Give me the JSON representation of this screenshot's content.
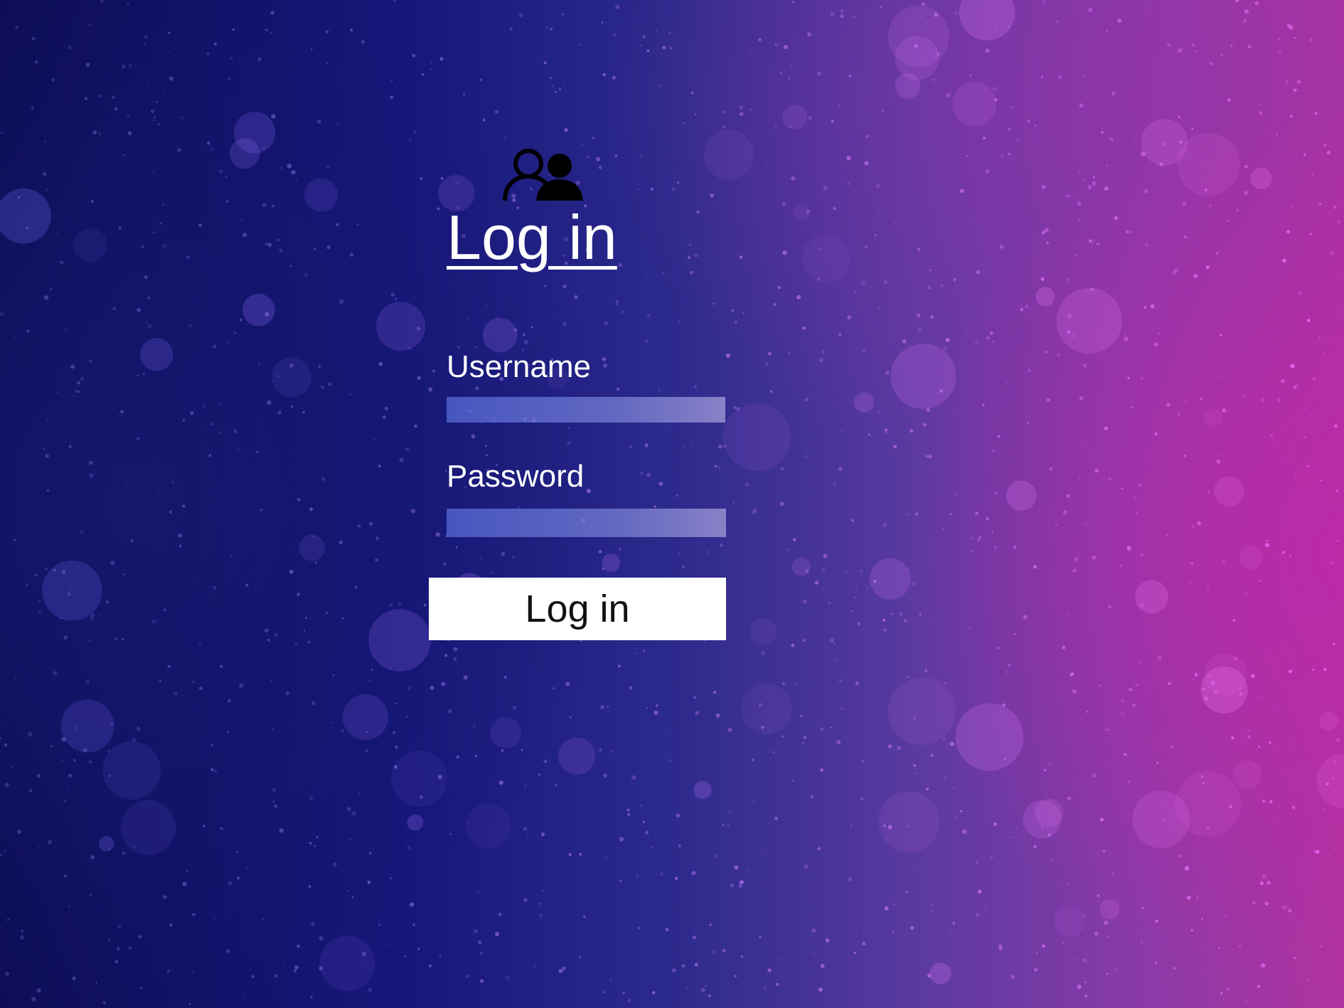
{
  "login_form": {
    "title": "Log in",
    "icon": "users-icon",
    "username": {
      "label": "Username",
      "value": "",
      "placeholder": ""
    },
    "password": {
      "label": "Password",
      "value": "",
      "placeholder": ""
    },
    "submit_label": "Log in"
  },
  "colors": {
    "background_left": "#0d0d55",
    "background_right": "#b0339f",
    "text": "#ffffff",
    "input_fill": "#5a6edc",
    "button_fill": "#ffffff",
    "button_text": "#111111"
  }
}
